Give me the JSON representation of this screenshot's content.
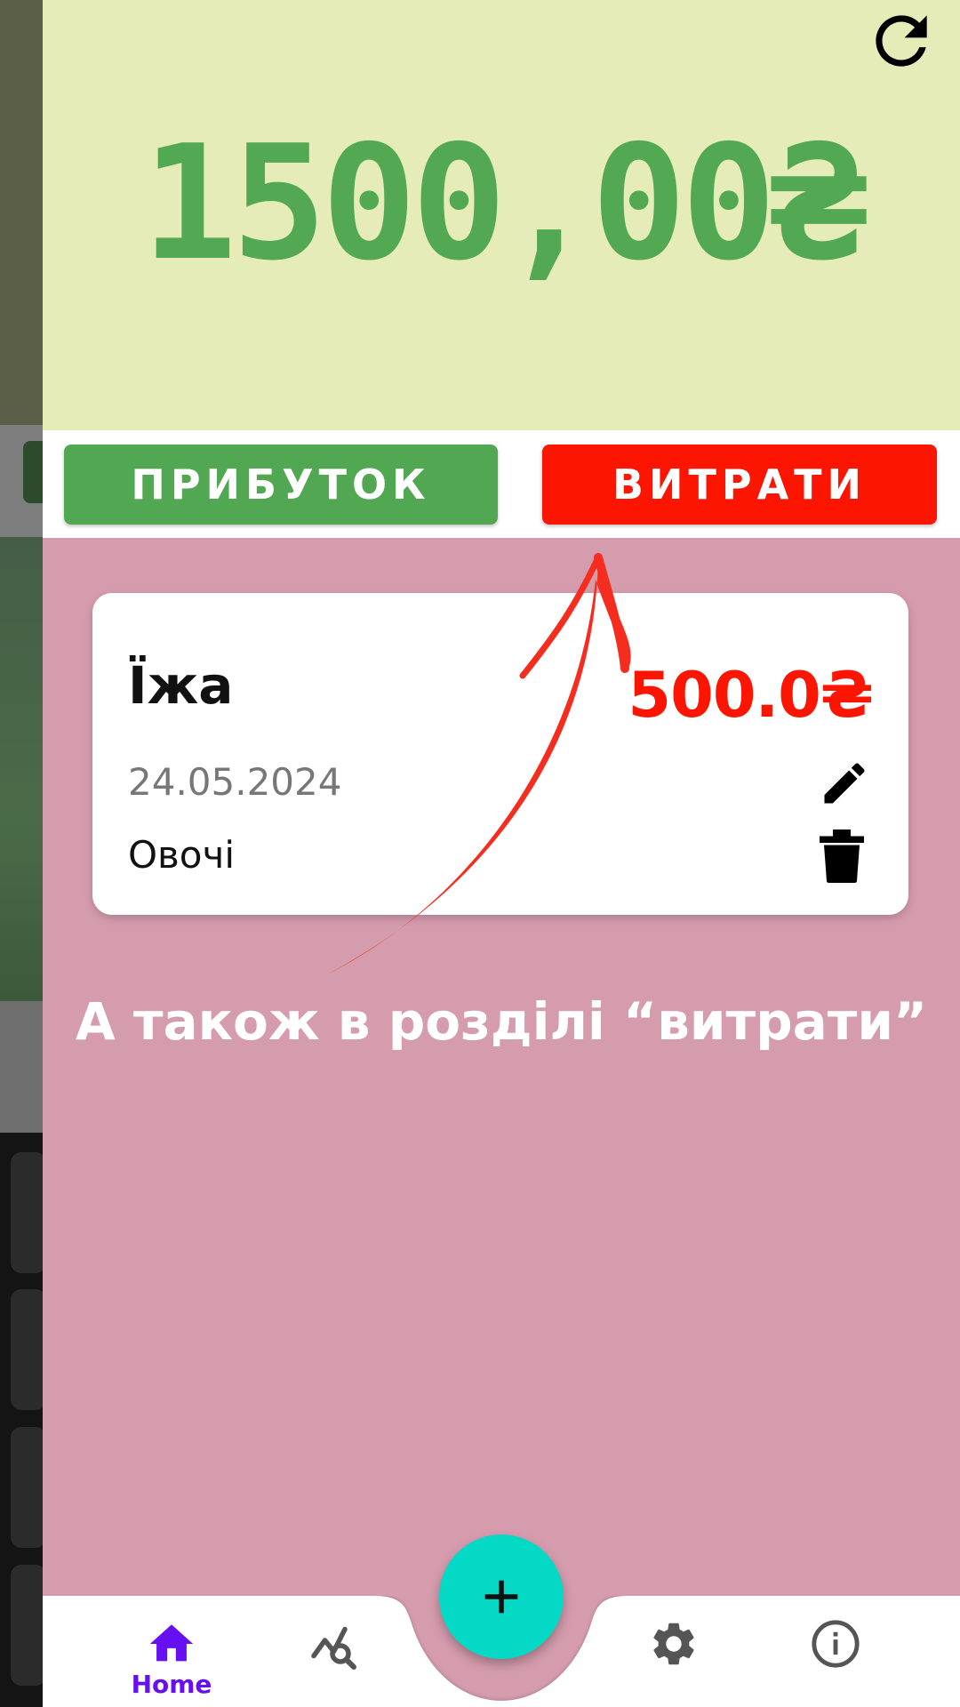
{
  "balance": {
    "amount": "1500,00₴"
  },
  "tabs": {
    "income_label": "ПРИБУТОК",
    "expense_label": "ВИТРАТИ"
  },
  "transaction": {
    "category": "Їжа",
    "amount": "500.0₴",
    "date": "24.05.2024",
    "note": "Овочі"
  },
  "annotation": {
    "text": "А також в розділі “витрати”"
  },
  "nav": {
    "home_label": "Home",
    "items": [
      "home-icon",
      "chart-search-icon",
      "add-icon",
      "gear-icon",
      "info-icon"
    ]
  },
  "colors": {
    "income_green": "#52a852",
    "expense_red": "#fc1501",
    "balance_green": "#53a853",
    "fab_teal": "#04d9c6",
    "active_purple": "#6610f2"
  }
}
